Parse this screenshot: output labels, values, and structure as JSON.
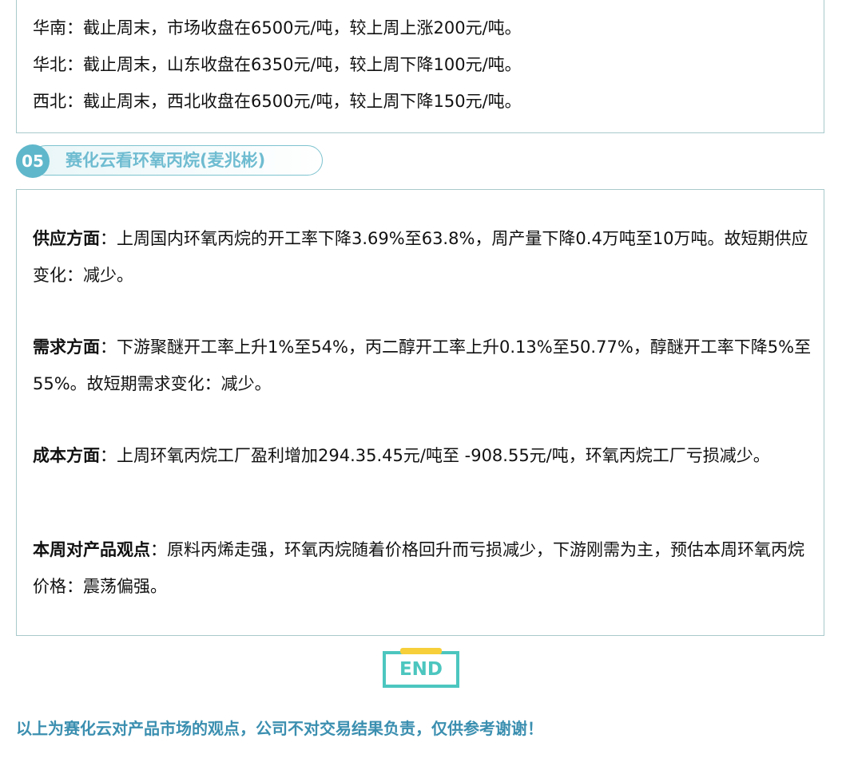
{
  "regions": [
    {
      "text": "华南：截止周末，市场收盘在6500元/吨，较上周上涨200元/吨。"
    },
    {
      "text": "华北：截止周末，山东收盘在6350元/吨，较上周下降100元/吨。"
    },
    {
      "text": "西北：截止周末，西北收盘在6500元/吨，较上周下降150元/吨。"
    }
  ],
  "section": {
    "number": "05",
    "title": "赛化云看环氧丙烷(麦兆彬)"
  },
  "paragraphs": [
    {
      "label": "供应方面",
      "text": "：上周国内环氧丙烷的开工率下降3.69%至63.8%，周产量下降0.4万吨至10万吨。故短期供应变化：减少。"
    },
    {
      "label": "需求方面",
      "text": "：下游聚醚开工率上升1%至54%，丙二醇开工率上升0.13%至50.77%，醇醚开工率下降5%至55%。故短期需求变化：减少。"
    },
    {
      "label": "成本方面",
      "text": "：上周环氧丙烷工厂盈利增加294.35.45元/吨至 -908.55元/吨，环氧丙烷工厂亏损减少。"
    },
    {
      "label": "本周对产品观点",
      "text": "：原料丙烯走强，环氧丙烷随着价格回升而亏损减少，下游刚需为主，预估本周环氧丙烷价格：震荡偏强。"
    }
  ],
  "end_badge": "END",
  "footer": "以上为赛化云对产品市场的观点，公司不对交易结果负责，仅供参考谢谢！",
  "colors": {
    "accent_teal": "#4cc6bf",
    "accent_blue": "#5fb7cb",
    "clip_yellow": "#f6cf3a",
    "footer_blue": "#3b8fb0",
    "border": "#a9c9cb"
  }
}
